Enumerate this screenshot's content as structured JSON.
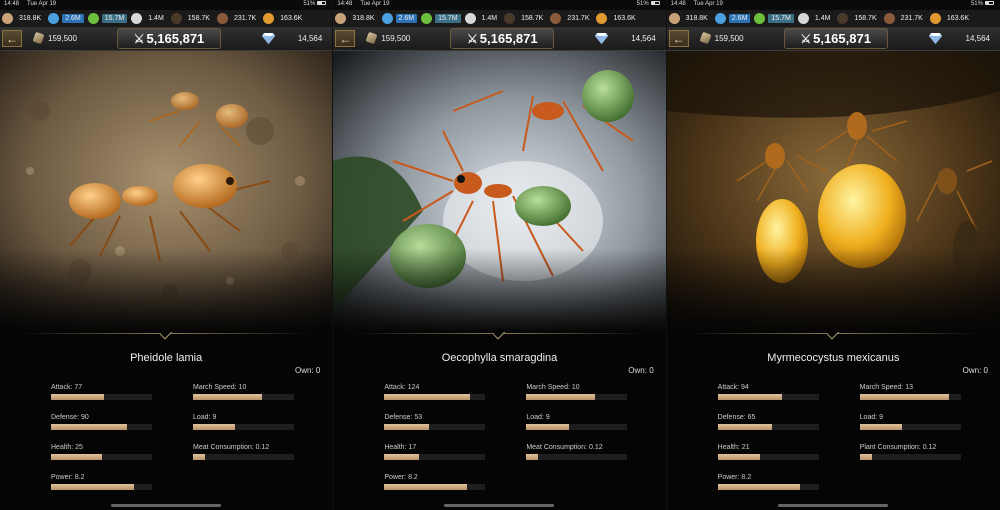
{
  "status": {
    "time": "14:48",
    "date": "Tue Apr 19",
    "battery": "51%"
  },
  "resources": [
    {
      "icon": "meat-icon",
      "value": "318.8K",
      "color": "#c9a27a",
      "hl": ""
    },
    {
      "icon": "water-icon",
      "value": "2.6M",
      "color": "#4aa0e0",
      "hl": "hl-blue"
    },
    {
      "icon": "leaf-icon",
      "value": "15.7M",
      "color": "#6fbf3f",
      "hl": "hl-teal"
    },
    {
      "icon": "sand-icon",
      "value": "1.4M",
      "color": "#d8d8d8",
      "hl": ""
    },
    {
      "icon": "wet-soil-icon",
      "value": "158.7K",
      "color": "#4a3a2a",
      "hl": ""
    },
    {
      "icon": "soil-icon",
      "value": "231.7K",
      "color": "#8a5a3a",
      "hl": ""
    },
    {
      "icon": "honeydew-icon",
      "value": "163.6K",
      "color": "#e09a30",
      "hl": ""
    }
  ],
  "header": {
    "back_label": "←",
    "food": "159,500",
    "power": "5,165,871",
    "gems": "14,564"
  },
  "labels": {
    "own": "Own:",
    "attack": "Attack:",
    "defense": "Defense:",
    "health": "Health:",
    "power": "Power:",
    "march_speed": "March Speed:",
    "load": "Load:"
  },
  "ants": [
    {
      "name": "Pheidole lamia",
      "own": "0",
      "attack": "77",
      "attack_pct": 0.52,
      "defense": "90",
      "defense_pct": 0.75,
      "health": "25",
      "health_pct": 0.5,
      "power": "8.2",
      "power_pct": 0.82,
      "march_speed": "10",
      "march_pct": 0.68,
      "load": "9",
      "load_pct": 0.42,
      "consumption_label": "Meat Consumption:",
      "consumption": "0.12",
      "consumption_pct": 0.12
    },
    {
      "name": "Oecophylla smaragdina",
      "own": "0",
      "attack": "124",
      "attack_pct": 0.85,
      "defense": "53",
      "defense_pct": 0.44,
      "health": "17",
      "health_pct": 0.34,
      "power": "8.2",
      "power_pct": 0.82,
      "march_speed": "10",
      "march_pct": 0.68,
      "load": "9",
      "load_pct": 0.42,
      "consumption_label": "Meat Consumption:",
      "consumption": "0.12",
      "consumption_pct": 0.12
    },
    {
      "name": "Myrmecocystus mexicanus",
      "own": "0",
      "attack": "94",
      "attack_pct": 0.64,
      "defense": "65",
      "defense_pct": 0.54,
      "health": "21",
      "health_pct": 0.42,
      "power": "8.2",
      "power_pct": 0.82,
      "march_speed": "13",
      "march_pct": 0.88,
      "load": "9",
      "load_pct": 0.42,
      "consumption_label": "Plant Consumption:",
      "consumption": "0.12",
      "consumption_pct": 0.12
    }
  ]
}
